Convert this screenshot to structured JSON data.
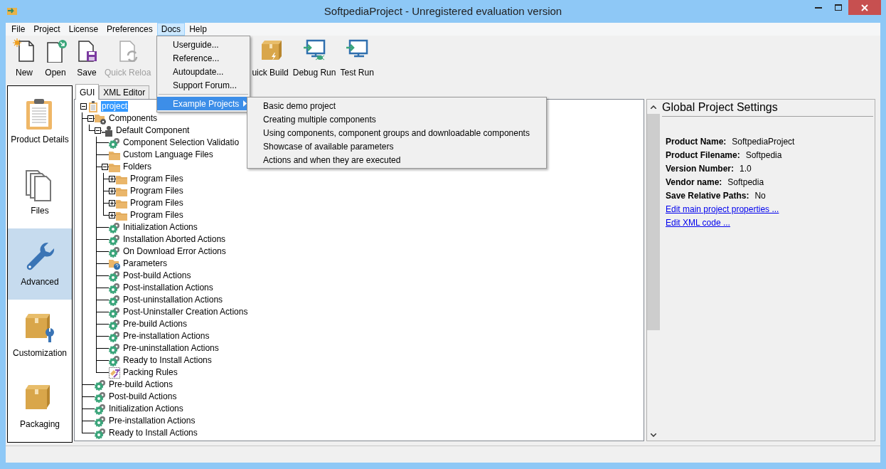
{
  "window": {
    "title": "SoftpediaProject - Unregistered evaluation version"
  },
  "menu_bar": [
    {
      "label": "File",
      "selected": false
    },
    {
      "label": "Project",
      "selected": false
    },
    {
      "label": "License",
      "selected": false
    },
    {
      "label": "Preferences",
      "selected": false
    },
    {
      "label": "Docs",
      "selected": true
    },
    {
      "label": "Help",
      "selected": false
    }
  ],
  "toolbar": [
    {
      "label": "New",
      "kind": "new",
      "disabled": false
    },
    {
      "label": "Open",
      "kind": "open",
      "disabled": false
    },
    {
      "label": "Save",
      "kind": "save",
      "disabled": false
    },
    {
      "label": "Quick Reloa",
      "kind": "reload",
      "disabled": true
    },
    {
      "label": "uick Build",
      "kind": "build",
      "disabled": false
    },
    {
      "label": "Debug Run",
      "kind": "debug",
      "disabled": false
    },
    {
      "label": "Test Run",
      "kind": "run",
      "disabled": false
    }
  ],
  "docs_menu": {
    "items": [
      {
        "kind": "item",
        "label": "Userguide...",
        "highlighted": false
      },
      {
        "kind": "item",
        "label": "Reference...",
        "highlighted": false
      },
      {
        "kind": "item",
        "label": "Autoupdate...",
        "highlighted": false
      },
      {
        "kind": "item",
        "label": "Support Forum...",
        "highlighted": false
      },
      {
        "kind": "separator"
      },
      {
        "kind": "submenu",
        "label": "Example Projects",
        "highlighted": true
      }
    ]
  },
  "example_projects_menu": {
    "items": [
      "Basic demo project",
      "Creating multiple components",
      "Using components, component groups and downloadable components",
      "Showcase of available parameters",
      "Actions and when they are executed"
    ]
  },
  "sidebar": {
    "items": [
      {
        "label": "Product Details",
        "kind": "clipboard",
        "selected": false
      },
      {
        "label": "Files",
        "kind": "files",
        "selected": false
      },
      {
        "label": "Advanced",
        "kind": "wrench",
        "selected": true
      },
      {
        "label": "Customization",
        "kind": "box-wrench",
        "selected": false
      },
      {
        "label": "Packaging",
        "kind": "box",
        "selected": false
      }
    ]
  },
  "tabs": [
    {
      "label": "GUI",
      "selected": true
    },
    {
      "label": "XML Editor",
      "selected": false
    }
  ],
  "tree": {
    "items": [
      {
        "label": "project",
        "kind": "document",
        "selected": true,
        "expanded": true,
        "children": [
          {
            "label": "Components",
            "kind": "folder-gear",
            "selected": false,
            "expanded": true,
            "children": [
              {
                "label": "Default Component",
                "kind": "component",
                "selected": false,
                "expanded": true,
                "children": [
                  {
                    "label": "Component Selection Validatio",
                    "kind": "gear",
                    "selected": false
                  },
                  {
                    "label": "Custom Language Files",
                    "kind": "folder",
                    "selected": false
                  },
                  {
                    "label": "Folders",
                    "kind": "folder",
                    "selected": false,
                    "expanded": true,
                    "children": [
                      {
                        "label": "Program Files",
                        "kind": "folder",
                        "selected": false,
                        "expanded": false
                      },
                      {
                        "label": "Program Files",
                        "kind": "folder",
                        "selected": false,
                        "expanded": false
                      },
                      {
                        "label": "Program Files",
                        "kind": "folder",
                        "selected": false,
                        "expanded": false
                      },
                      {
                        "label": "Program Files",
                        "kind": "folder",
                        "selected": false,
                        "expanded": false
                      }
                    ]
                  },
                  {
                    "label": "Initialization Actions",
                    "kind": "gear",
                    "selected": false
                  },
                  {
                    "label": "Installation Aborted Actions",
                    "kind": "gear",
                    "selected": false
                  },
                  {
                    "label": "On Download Error Actions",
                    "kind": "gear",
                    "selected": false
                  },
                  {
                    "label": "Parameters",
                    "kind": "parameters",
                    "selected": false
                  },
                  {
                    "label": "Post-build Actions",
                    "kind": "gear",
                    "selected": false
                  },
                  {
                    "label": "Post-installation Actions",
                    "kind": "gear",
                    "selected": false
                  },
                  {
                    "label": "Post-uninstallation Actions",
                    "kind": "gear",
                    "selected": false
                  },
                  {
                    "label": "Post-Uninstaller Creation Actions",
                    "kind": "gear",
                    "selected": false
                  },
                  {
                    "label": "Pre-build Actions",
                    "kind": "gear",
                    "selected": false
                  },
                  {
                    "label": "Pre-installation Actions",
                    "kind": "gear",
                    "selected": false
                  },
                  {
                    "label": "Pre-uninstallation Actions",
                    "kind": "gear",
                    "selected": false
                  },
                  {
                    "label": "Ready to Install Actions",
                    "kind": "gear",
                    "selected": false
                  },
                  {
                    "label": "Packing Rules",
                    "kind": "rules",
                    "selected": false
                  }
                ]
              }
            ]
          },
          {
            "label": "Pre-build Actions",
            "kind": "gear",
            "selected": false
          },
          {
            "label": "Post-build Actions",
            "kind": "gear",
            "selected": false
          },
          {
            "label": "Initialization Actions",
            "kind": "gear",
            "selected": false
          },
          {
            "label": "Pre-installation Actions",
            "kind": "gear",
            "selected": false
          },
          {
            "label": "Ready to Install Actions",
            "kind": "gear",
            "selected": false
          }
        ]
      }
    ]
  },
  "settings": {
    "title": "Global Project Settings",
    "fields": [
      {
        "label": "Product Name:",
        "value": "SoftpediaProject"
      },
      {
        "label": "Product Filename:",
        "value": "Softpedia"
      },
      {
        "label": "Version Number:",
        "value": "1.0"
      },
      {
        "label": "Vendor name:",
        "value": "Softpedia"
      },
      {
        "label": "Save Relative Paths:",
        "value": "No"
      }
    ],
    "links": [
      "Edit main project properties ...",
      "Edit XML code ..."
    ]
  }
}
